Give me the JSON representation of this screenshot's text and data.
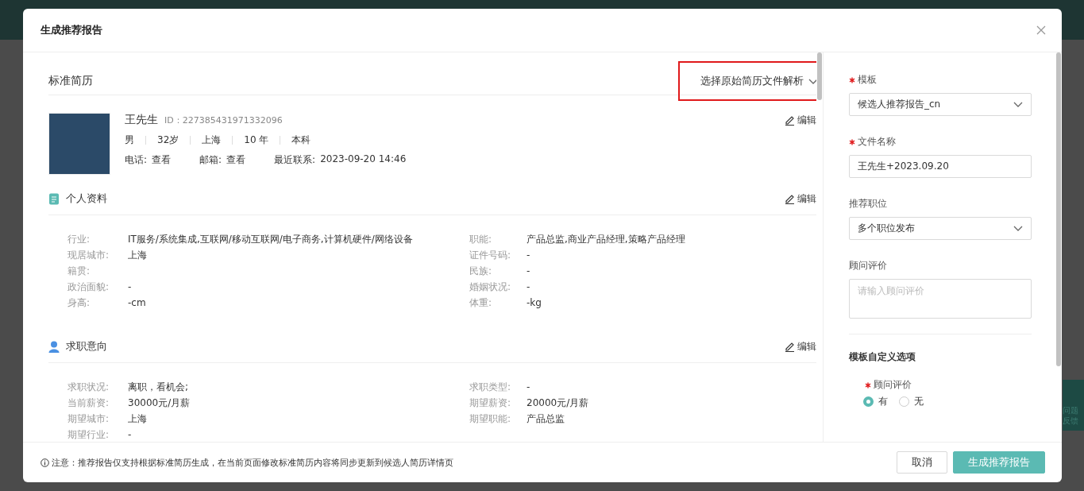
{
  "dialog": {
    "title": "生成推荐报告"
  },
  "resume": {
    "title": "标准简历",
    "parse_button": {
      "label": "选择原始简历文件解析",
      "annotated": true
    },
    "candidate": {
      "name": "王先生",
      "id": "ID：227385431971332096",
      "edit": "编辑",
      "facts": [
        "男",
        "32岁",
        "上海",
        "10 年",
        "本科"
      ],
      "contacts": [
        {
          "label": "电话:",
          "value": "查看"
        },
        {
          "label": "邮箱:",
          "value": "查看"
        },
        {
          "label": "最近联系:",
          "value": "2023-09-20 14:46"
        }
      ]
    },
    "sections": [
      {
        "kind": "profile",
        "title": "个人资料",
        "edit": "编辑",
        "fields": [
          {
            "label": "行业:",
            "value": "IT服务/系统集成,互联网/移动互联网/电子商务,计算机硬件/网络设备"
          },
          {
            "label": "职能:",
            "value": "产品总监,商业产品经理,策略产品经理"
          },
          {
            "label": "现居城市:",
            "value": "上海"
          },
          {
            "label": "证件号码:",
            "value": "-"
          },
          {
            "label": "籍贯:"
          },
          {
            "label": "民族:",
            "value": "-"
          },
          {
            "label": "政治面貌:",
            "value": "-"
          },
          {
            "label": "婚姻状况:",
            "value": "-"
          },
          {
            "label": "身高:",
            "value": "-cm"
          },
          {
            "label": "体重:",
            "value": "-kg"
          }
        ]
      },
      {
        "kind": "intent",
        "title": "求职意向",
        "edit": "编辑",
        "fields": [
          {
            "label": "求职状况:",
            "value": "离职，看机会;"
          },
          {
            "label": "求职类型:",
            "value": "-"
          },
          {
            "label": "当前薪资:",
            "value": "30000元/月薪"
          },
          {
            "label": "期望薪资:",
            "value": "20000元/月薪"
          },
          {
            "label": "期望城市:",
            "value": "上海"
          },
          {
            "label": "期望职能:",
            "value": "产品总监"
          },
          {
            "label": "期望行业:",
            "value": "-"
          }
        ]
      }
    ]
  },
  "form": {
    "fields": [
      {
        "kind": "select",
        "label": "模板",
        "required": true,
        "value": "候选人推荐报告_cn"
      },
      {
        "kind": "input",
        "label": "文件名称",
        "required": true,
        "value": "王先生+2023.09.20"
      },
      {
        "kind": "select",
        "label": "推荐职位",
        "required": false,
        "value": "多个职位发布"
      },
      {
        "kind": "textarea",
        "label": "顾问评价",
        "required": false,
        "placeholder": "请输入顾问评价"
      }
    ],
    "custom_title": "模板自定义选项",
    "custom_field": {
      "label": "顾问评价",
      "required": true,
      "options": [
        {
          "label": "有",
          "selected": true
        },
        {
          "label": "无",
          "selected": false
        }
      ]
    }
  },
  "footer": {
    "note": "注意：推荐报告仅支持根据标准简历生成，在当前页面修改标准简历内容将同步更新到候选人简历详情页",
    "buttons": [
      {
        "kind": "secondary",
        "label": "取消"
      },
      {
        "kind": "primary",
        "label": "生成推荐报告"
      }
    ]
  },
  "side_tab": {
    "lines": [
      "问题",
      "反馈"
    ]
  }
}
